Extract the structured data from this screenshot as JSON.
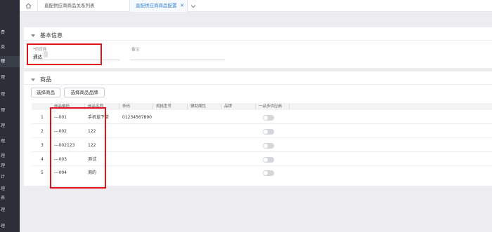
{
  "sidebar": {
    "items": [
      "费",
      "类",
      "理",
      "理",
      "理",
      "理",
      "理",
      "理",
      "理",
      "理",
      "计",
      "理",
      "表",
      "理",
      "理"
    ]
  },
  "tabs": {
    "home_icon": "home-icon",
    "tab1": "直配供应商商品关系列表",
    "tab2": "直配供应商商品配置",
    "close": "✕"
  },
  "basic": {
    "title": "基本信息",
    "supplier_label": "供应商",
    "supplier_required": "*",
    "supplier_value": "通达",
    "remark_label": "备注",
    "remark_value": ""
  },
  "goods": {
    "title": "商品",
    "btn_select_goods": "选择商品",
    "btn_select_brand": "选择商品品牌",
    "columns": [
      "商品编码",
      "商品名称",
      "条码",
      "规格型号",
      "辅助属性",
      "品牌",
      "一品多供应商"
    ],
    "rows": [
      {
        "no": "1",
        "code": "---001",
        "name": "手机挂下单",
        "barcode": "01234567890",
        "spec": "",
        "attr": "",
        "brand": ""
      },
      {
        "no": "2",
        "code": "---002",
        "name": "122",
        "barcode": "",
        "spec": "",
        "attr": "",
        "brand": ""
      },
      {
        "no": "3",
        "code": "---002123",
        "name": "122",
        "barcode": "",
        "spec": "",
        "attr": "",
        "brand": ""
      },
      {
        "no": "4",
        "code": "---003",
        "name": "测试",
        "barcode": "",
        "spec": "",
        "attr": "",
        "brand": ""
      },
      {
        "no": "5",
        "code": "---004",
        "name": "测的",
        "barcode": "",
        "spec": "",
        "attr": "",
        "brand": ""
      }
    ],
    "multi_supplier": [
      false,
      false,
      false,
      false,
      false
    ]
  },
  "colors": {
    "sidebar": "#2c2f38",
    "accent": "#2f7fd6",
    "highlight": "#e0141c"
  }
}
